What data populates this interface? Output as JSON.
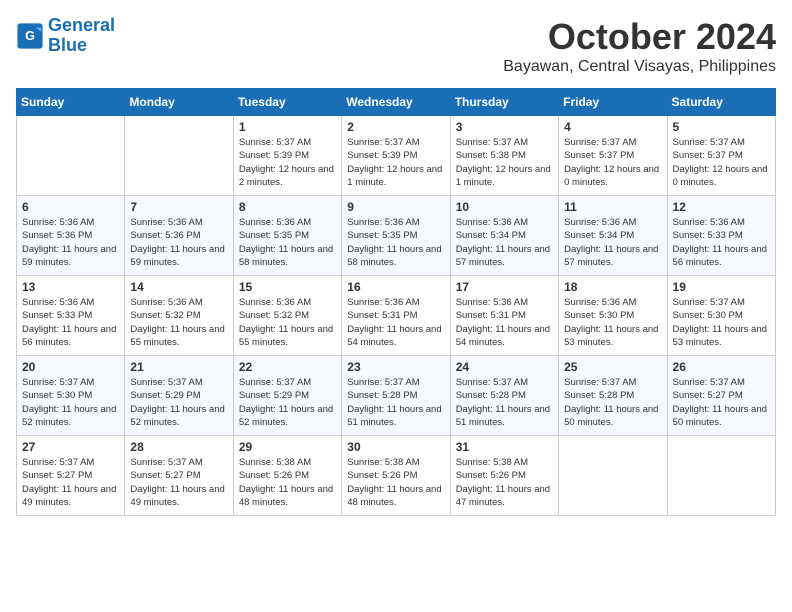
{
  "header": {
    "logo_line1": "General",
    "logo_line2": "Blue",
    "month": "October 2024",
    "location": "Bayawan, Central Visayas, Philippines"
  },
  "weekdays": [
    "Sunday",
    "Monday",
    "Tuesday",
    "Wednesday",
    "Thursday",
    "Friday",
    "Saturday"
  ],
  "weeks": [
    [
      {
        "day": "",
        "sunrise": "",
        "sunset": "",
        "daylight": ""
      },
      {
        "day": "",
        "sunrise": "",
        "sunset": "",
        "daylight": ""
      },
      {
        "day": "1",
        "sunrise": "Sunrise: 5:37 AM",
        "sunset": "Sunset: 5:39 PM",
        "daylight": "Daylight: 12 hours and 2 minutes."
      },
      {
        "day": "2",
        "sunrise": "Sunrise: 5:37 AM",
        "sunset": "Sunset: 5:39 PM",
        "daylight": "Daylight: 12 hours and 1 minute."
      },
      {
        "day": "3",
        "sunrise": "Sunrise: 5:37 AM",
        "sunset": "Sunset: 5:38 PM",
        "daylight": "Daylight: 12 hours and 1 minute."
      },
      {
        "day": "4",
        "sunrise": "Sunrise: 5:37 AM",
        "sunset": "Sunset: 5:37 PM",
        "daylight": "Daylight: 12 hours and 0 minutes."
      },
      {
        "day": "5",
        "sunrise": "Sunrise: 5:37 AM",
        "sunset": "Sunset: 5:37 PM",
        "daylight": "Daylight: 12 hours and 0 minutes."
      }
    ],
    [
      {
        "day": "6",
        "sunrise": "Sunrise: 5:36 AM",
        "sunset": "Sunset: 5:36 PM",
        "daylight": "Daylight: 11 hours and 59 minutes."
      },
      {
        "day": "7",
        "sunrise": "Sunrise: 5:36 AM",
        "sunset": "Sunset: 5:36 PM",
        "daylight": "Daylight: 11 hours and 59 minutes."
      },
      {
        "day": "8",
        "sunrise": "Sunrise: 5:36 AM",
        "sunset": "Sunset: 5:35 PM",
        "daylight": "Daylight: 11 hours and 58 minutes."
      },
      {
        "day": "9",
        "sunrise": "Sunrise: 5:36 AM",
        "sunset": "Sunset: 5:35 PM",
        "daylight": "Daylight: 11 hours and 58 minutes."
      },
      {
        "day": "10",
        "sunrise": "Sunrise: 5:36 AM",
        "sunset": "Sunset: 5:34 PM",
        "daylight": "Daylight: 11 hours and 57 minutes."
      },
      {
        "day": "11",
        "sunrise": "Sunrise: 5:36 AM",
        "sunset": "Sunset: 5:34 PM",
        "daylight": "Daylight: 11 hours and 57 minutes."
      },
      {
        "day": "12",
        "sunrise": "Sunrise: 5:36 AM",
        "sunset": "Sunset: 5:33 PM",
        "daylight": "Daylight: 11 hours and 56 minutes."
      }
    ],
    [
      {
        "day": "13",
        "sunrise": "Sunrise: 5:36 AM",
        "sunset": "Sunset: 5:33 PM",
        "daylight": "Daylight: 11 hours and 56 minutes."
      },
      {
        "day": "14",
        "sunrise": "Sunrise: 5:36 AM",
        "sunset": "Sunset: 5:32 PM",
        "daylight": "Daylight: 11 hours and 55 minutes."
      },
      {
        "day": "15",
        "sunrise": "Sunrise: 5:36 AM",
        "sunset": "Sunset: 5:32 PM",
        "daylight": "Daylight: 11 hours and 55 minutes."
      },
      {
        "day": "16",
        "sunrise": "Sunrise: 5:36 AM",
        "sunset": "Sunset: 5:31 PM",
        "daylight": "Daylight: 11 hours and 54 minutes."
      },
      {
        "day": "17",
        "sunrise": "Sunrise: 5:36 AM",
        "sunset": "Sunset: 5:31 PM",
        "daylight": "Daylight: 11 hours and 54 minutes."
      },
      {
        "day": "18",
        "sunrise": "Sunrise: 5:36 AM",
        "sunset": "Sunset: 5:30 PM",
        "daylight": "Daylight: 11 hours and 53 minutes."
      },
      {
        "day": "19",
        "sunrise": "Sunrise: 5:37 AM",
        "sunset": "Sunset: 5:30 PM",
        "daylight": "Daylight: 11 hours and 53 minutes."
      }
    ],
    [
      {
        "day": "20",
        "sunrise": "Sunrise: 5:37 AM",
        "sunset": "Sunset: 5:30 PM",
        "daylight": "Daylight: 11 hours and 52 minutes."
      },
      {
        "day": "21",
        "sunrise": "Sunrise: 5:37 AM",
        "sunset": "Sunset: 5:29 PM",
        "daylight": "Daylight: 11 hours and 52 minutes."
      },
      {
        "day": "22",
        "sunrise": "Sunrise: 5:37 AM",
        "sunset": "Sunset: 5:29 PM",
        "daylight": "Daylight: 11 hours and 52 minutes."
      },
      {
        "day": "23",
        "sunrise": "Sunrise: 5:37 AM",
        "sunset": "Sunset: 5:28 PM",
        "daylight": "Daylight: 11 hours and 51 minutes."
      },
      {
        "day": "24",
        "sunrise": "Sunrise: 5:37 AM",
        "sunset": "Sunset: 5:28 PM",
        "daylight": "Daylight: 11 hours and 51 minutes."
      },
      {
        "day": "25",
        "sunrise": "Sunrise: 5:37 AM",
        "sunset": "Sunset: 5:28 PM",
        "daylight": "Daylight: 11 hours and 50 minutes."
      },
      {
        "day": "26",
        "sunrise": "Sunrise: 5:37 AM",
        "sunset": "Sunset: 5:27 PM",
        "daylight": "Daylight: 11 hours and 50 minutes."
      }
    ],
    [
      {
        "day": "27",
        "sunrise": "Sunrise: 5:37 AM",
        "sunset": "Sunset: 5:27 PM",
        "daylight": "Daylight: 11 hours and 49 minutes."
      },
      {
        "day": "28",
        "sunrise": "Sunrise: 5:37 AM",
        "sunset": "Sunset: 5:27 PM",
        "daylight": "Daylight: 11 hours and 49 minutes."
      },
      {
        "day": "29",
        "sunrise": "Sunrise: 5:38 AM",
        "sunset": "Sunset: 5:26 PM",
        "daylight": "Daylight: 11 hours and 48 minutes."
      },
      {
        "day": "30",
        "sunrise": "Sunrise: 5:38 AM",
        "sunset": "Sunset: 5:26 PM",
        "daylight": "Daylight: 11 hours and 48 minutes."
      },
      {
        "day": "31",
        "sunrise": "Sunrise: 5:38 AM",
        "sunset": "Sunset: 5:26 PM",
        "daylight": "Daylight: 11 hours and 47 minutes."
      },
      {
        "day": "",
        "sunrise": "",
        "sunset": "",
        "daylight": ""
      },
      {
        "day": "",
        "sunrise": "",
        "sunset": "",
        "daylight": ""
      }
    ]
  ]
}
